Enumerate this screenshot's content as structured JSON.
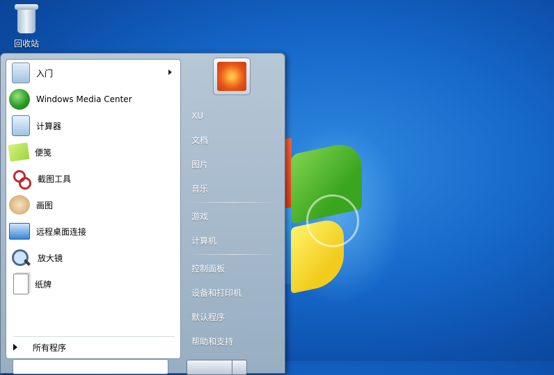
{
  "desktop": {
    "recycle_bin_label": "回收站"
  },
  "start_menu": {
    "pinned_programs": [
      {
        "label": "入门",
        "icon": "getting-started-icon",
        "has_submenu": true
      },
      {
        "label": "Windows Media Center",
        "icon": "media-center-icon",
        "has_submenu": false
      },
      {
        "label": "计算器",
        "icon": "calculator-icon",
        "has_submenu": false
      },
      {
        "label": "便笺",
        "icon": "sticky-notes-icon",
        "has_submenu": false
      },
      {
        "label": "截图工具",
        "icon": "snipping-tool-icon",
        "has_submenu": false
      },
      {
        "label": "画图",
        "icon": "paint-icon",
        "has_submenu": false
      },
      {
        "label": "远程桌面连接",
        "icon": "remote-desktop-icon",
        "has_submenu": false
      },
      {
        "label": "放大镜",
        "icon": "magnifier-icon",
        "has_submenu": false
      },
      {
        "label": "纸牌",
        "icon": "solitaire-icon",
        "has_submenu": false
      }
    ],
    "all_programs_label": "所有程序",
    "right_pane": {
      "user_name": "XU",
      "items_group1": [
        "文档",
        "图片",
        "音乐"
      ],
      "items_group2": [
        "游戏",
        "计算机"
      ],
      "items_group3": [
        "控制面板",
        "设备和打印机",
        "默认程序",
        "帮助和支持"
      ]
    }
  },
  "colors": {
    "desktop_blue": "#1566c8",
    "menu_frame": "#98aec2"
  }
}
